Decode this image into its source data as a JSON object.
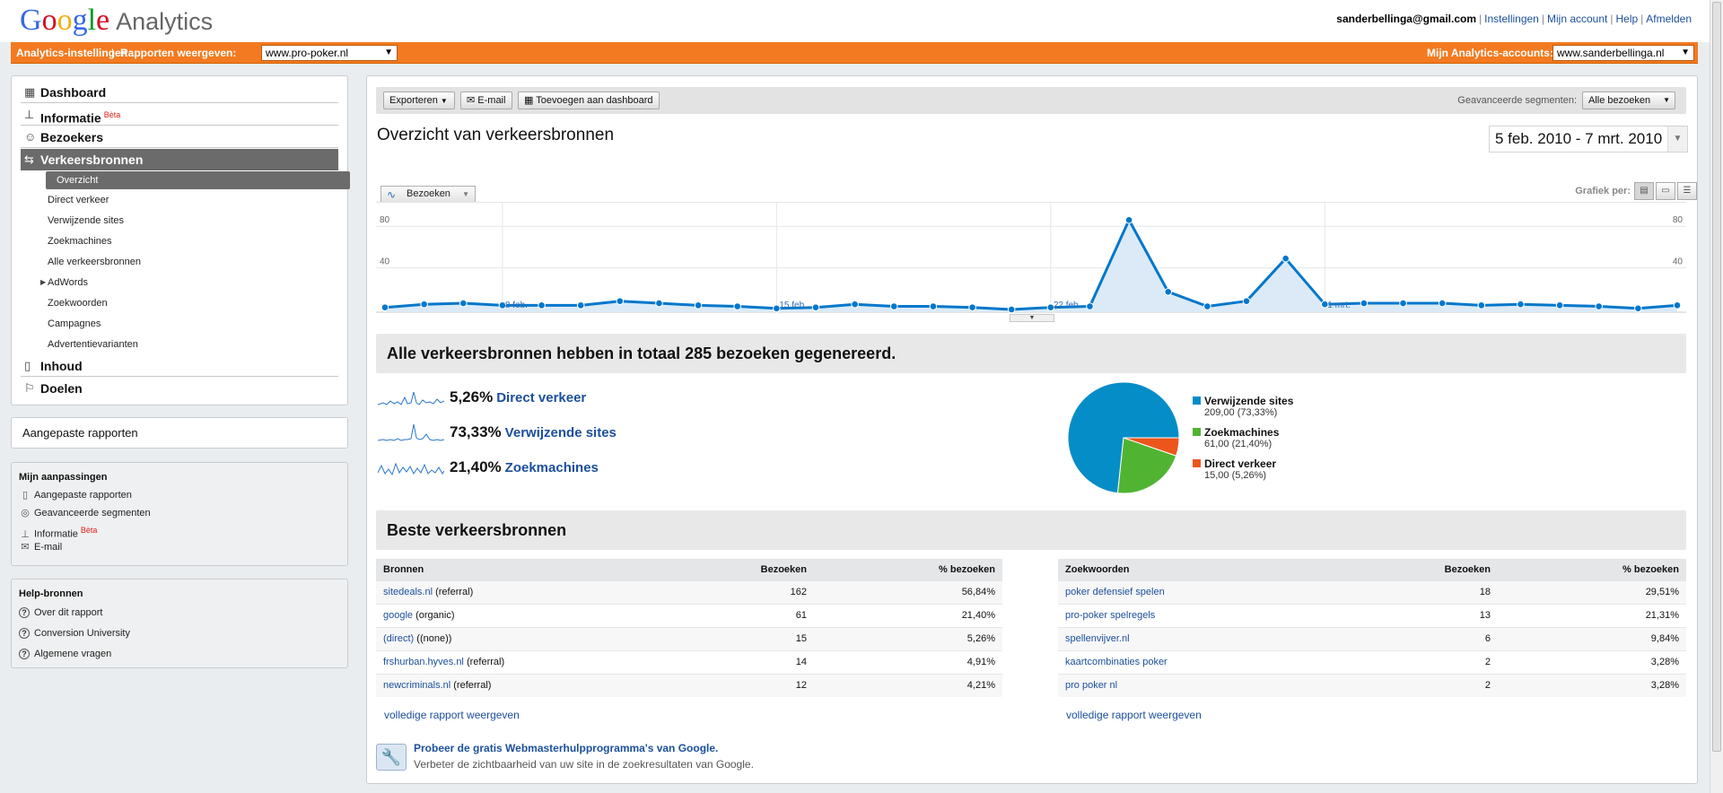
{
  "header": {
    "logo_google": "Google",
    "logo_analytics": "Analytics",
    "user_email": "sanderbellinga@gmail.com",
    "links": [
      "Instellingen",
      "Mijn account",
      "Help",
      "Afmelden"
    ]
  },
  "orangebar": {
    "settings_label": "Analytics-instellingen",
    "view_reports_label": "Rapporten weergeven:",
    "view_reports_value": "www.pro-poker.nl",
    "accounts_label": "Mijn Analytics-accounts:",
    "accounts_value": "www.sanderbellinga.nl"
  },
  "nav": {
    "items": [
      {
        "label": "Dashboard",
        "icon": "dashboard-icon"
      },
      {
        "label": "Informatie",
        "icon": "intelligence-icon",
        "badge": "Bèta"
      },
      {
        "label": "Bezoekers",
        "icon": "visitors-icon"
      },
      {
        "label": "Verkeersbronnen",
        "icon": "traffic-sources-icon"
      },
      {
        "label": "Inhoud",
        "icon": "content-icon"
      },
      {
        "label": "Doelen",
        "icon": "goals-icon"
      }
    ],
    "subitems": [
      "Overzicht",
      "Direct verkeer",
      "Verwijzende sites",
      "Zoekmachines",
      "Alle verkeersbronnen",
      "AdWords",
      "Zoekwoorden",
      "Campagnes",
      "Advertentievarianten"
    ]
  },
  "custom_reports": "Aangepaste rapporten",
  "mijn": {
    "title": "Mijn aanpassingen",
    "items": [
      "Aangepaste rapporten",
      "Geavanceerde segmenten",
      "Informatie",
      "E-mail"
    ],
    "badge": "Bèta"
  },
  "help": {
    "title": "Help-bronnen",
    "items": [
      "Over dit rapport",
      "Conversion University",
      "Algemene vragen"
    ]
  },
  "toolbar": {
    "export": "Exporteren",
    "email": "E-mail",
    "add_dashboard": "Toevoegen aan dashboard",
    "segments_label": "Geavanceerde segmenten:",
    "segments_value": "Alle bezoeken"
  },
  "page_title": "Overzicht van verkeersbronnen",
  "date_range": "5 feb. 2010 - 7 mrt. 2010",
  "chart_tab": "Bezoeken",
  "graph_per": "Grafiek per:",
  "chart_data": {
    "type": "area",
    "series": [
      {
        "name": "Bezoeken",
        "values": [
          2,
          5,
          6,
          4,
          4,
          4,
          8,
          6,
          4,
          3,
          1,
          2,
          5,
          3,
          3,
          2,
          0,
          2,
          3,
          86,
          17,
          3,
          8,
          49,
          5,
          6,
          6,
          6,
          4,
          5,
          4,
          3,
          1,
          4
        ]
      }
    ],
    "x_labels": [
      "8 feb.",
      "15 feb.",
      "22 feb.",
      "1 mrt."
    ],
    "y_ticks": [
      40,
      80
    ],
    "ylim": [
      0,
      100
    ],
    "color": "#0077cc"
  },
  "section1_title": "Alle verkeersbronnen hebben in totaal 285 bezoeken gegenereerd.",
  "breakdown": [
    {
      "pct": "5,26%",
      "label": "Direct verkeer"
    },
    {
      "pct": "73,33%",
      "label": "Verwijzende sites"
    },
    {
      "pct": "21,40%",
      "label": "Zoekmachines"
    }
  ],
  "pie": [
    {
      "name": "Verwijzende sites",
      "value": "209,00 (73,33%)",
      "share": 73.33,
      "color": "#058dc7"
    },
    {
      "name": "Zoekmachines",
      "value": "61,00 (21,40%)",
      "share": 21.4,
      "color": "#50b432"
    },
    {
      "name": "Direct verkeer",
      "value": "15,00 (5,26%)",
      "share": 5.26,
      "color": "#ed561b"
    }
  ],
  "section2_title": "Beste verkeersbronnen",
  "sources_table": {
    "headers": [
      "Bronnen",
      "Bezoeken",
      "% bezoeken"
    ],
    "rows": [
      {
        "link": "sitedeals.nl",
        "type": "(referral)",
        "visits": "162",
        "pct": "56,84%"
      },
      {
        "link": "google",
        "type": "(organic)",
        "visits": "61",
        "pct": "21,40%"
      },
      {
        "link": "(direct)",
        "type": "((none))",
        "visits": "15",
        "pct": "5,26%"
      },
      {
        "link": "frshurban.hyves.nl",
        "type": "(referral)",
        "visits": "14",
        "pct": "4,91%"
      },
      {
        "link": "newcriminals.nl",
        "type": "(referral)",
        "visits": "12",
        "pct": "4,21%"
      }
    ]
  },
  "keywords_table": {
    "headers": [
      "Zoekwoorden",
      "Bezoeken",
      "% bezoeken"
    ],
    "rows": [
      {
        "link": "poker defensief spelen",
        "visits": "18",
        "pct": "29,51%"
      },
      {
        "link": "pro-poker spelregels",
        "visits": "13",
        "pct": "21,31%"
      },
      {
        "link": "spellenvijver.nl",
        "visits": "6",
        "pct": "9,84%"
      },
      {
        "link": "kaartcombinaties poker",
        "visits": "2",
        "pct": "3,28%"
      },
      {
        "link": "pro poker nl",
        "visits": "2",
        "pct": "3,28%"
      }
    ]
  },
  "full_report": "volledige rapport weergeven",
  "promo": {
    "title": "Probeer de gratis Webmasterhulpprogramma's van Google.",
    "text": "Verbeter de zichtbaarheid van uw site in de zoekresultaten van Google."
  }
}
